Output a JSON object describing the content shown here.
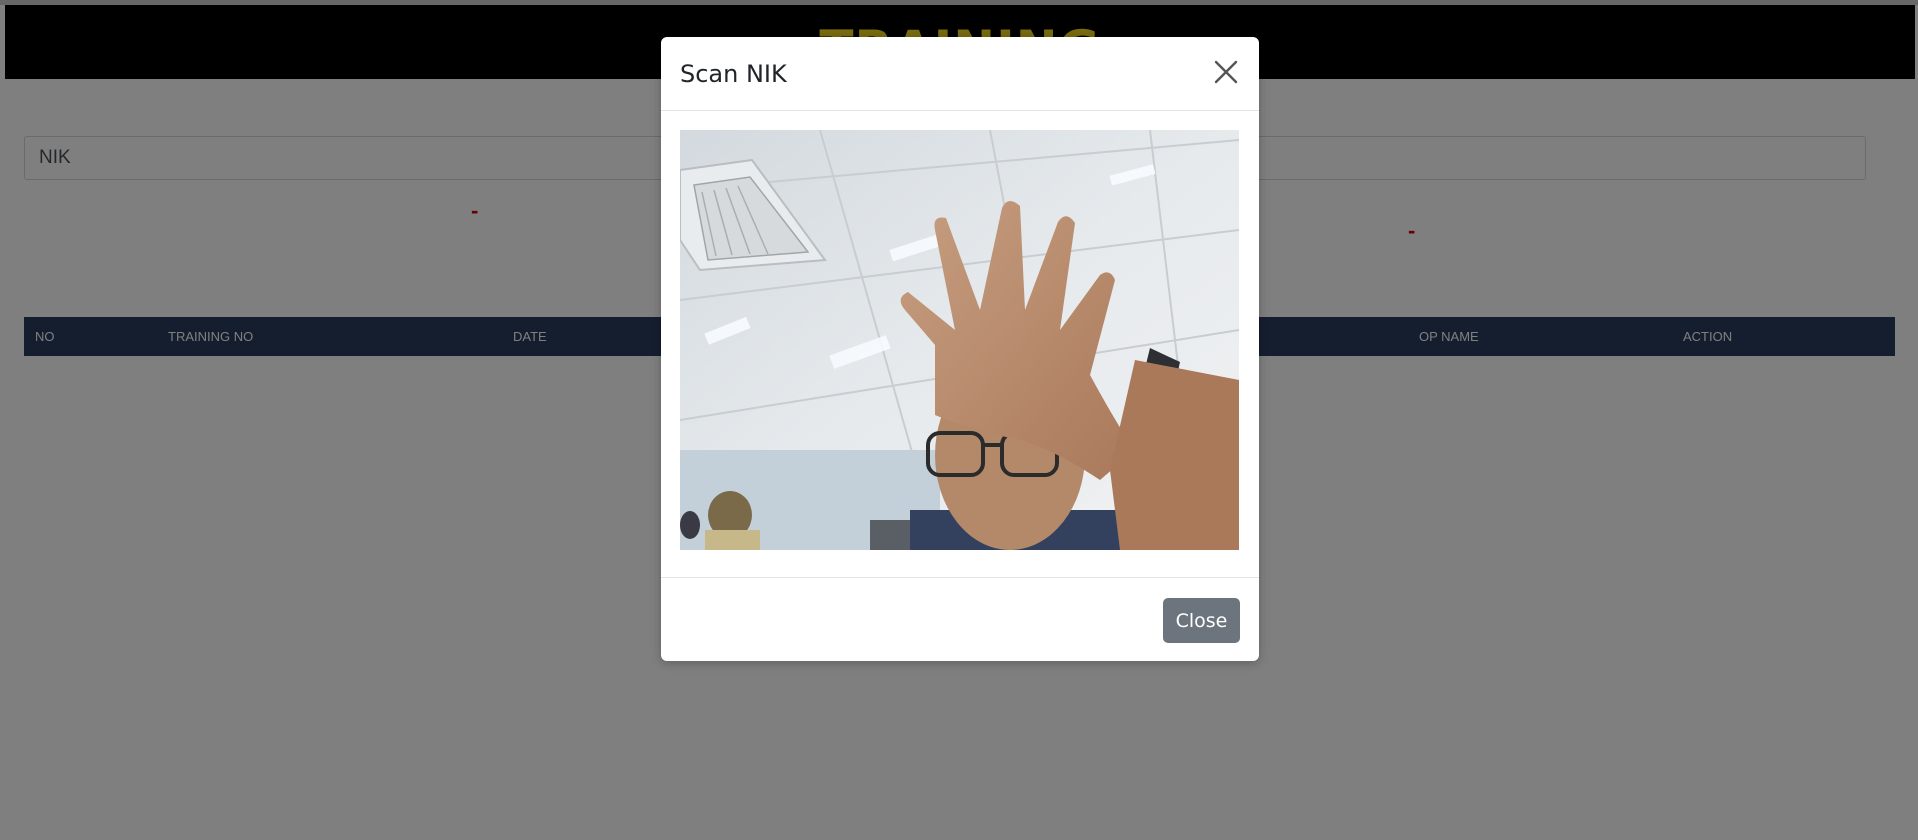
{
  "header": {
    "title": "TRAINING",
    "title_color": "#f2d61f"
  },
  "form": {
    "nik_placeholder": "NIK",
    "left_status": "-",
    "right_status": "-"
  },
  "table": {
    "columns": [
      "NO",
      "TRAINING NO",
      "DATE",
      "OP NAME",
      "ACTION"
    ],
    "rows": []
  },
  "modal": {
    "title": "Scan NIK",
    "close_label": "Close",
    "close_icon": "close-icon",
    "video_description": "camera-feed"
  },
  "colors": {
    "header_bg": "#000000",
    "table_head_bg": "#2a3d5f",
    "status_red": "#d10000",
    "button_secondary": "#6c757d"
  }
}
